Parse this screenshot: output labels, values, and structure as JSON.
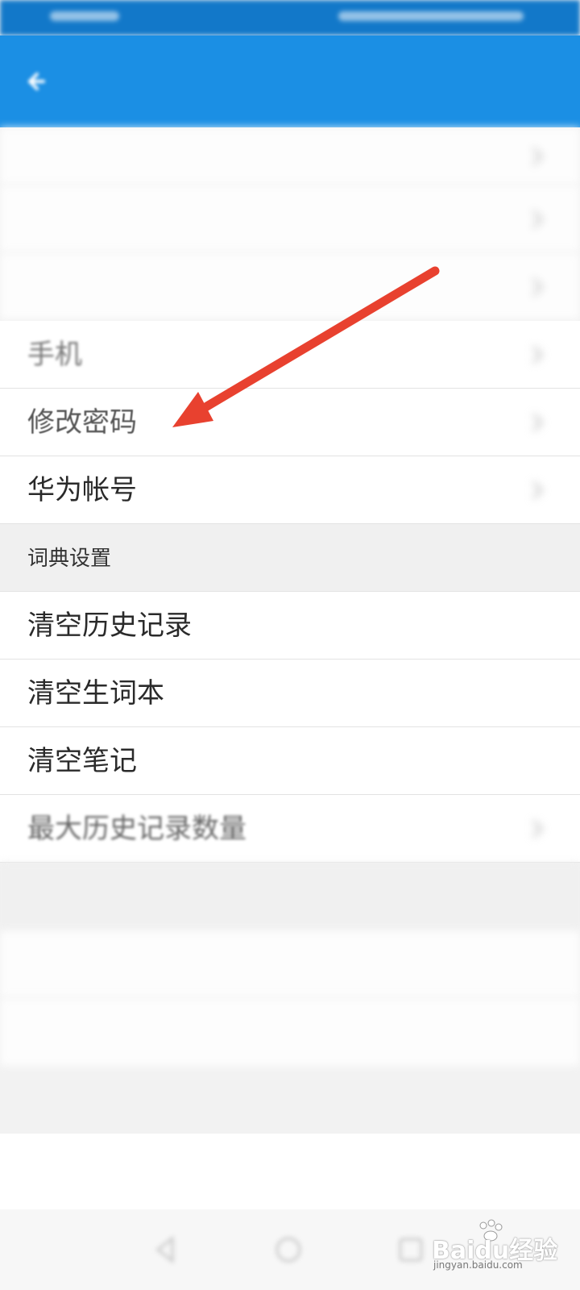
{
  "status_bar": {
    "carrier": "",
    "right_info": ""
  },
  "header": {
    "back_icon": "back-arrow-icon"
  },
  "account_rows": [
    {
      "label": "",
      "value": ""
    },
    {
      "label": "",
      "value": ""
    },
    {
      "label": "",
      "value": ""
    },
    {
      "label": "手机",
      "value": ""
    },
    {
      "label": "修改密码",
      "value": ""
    },
    {
      "label": "华为帐号",
      "value": ""
    }
  ],
  "dictionary_section": {
    "title": "词典设置",
    "items": [
      {
        "label": "清空历史记录"
      },
      {
        "label": "清空生词本"
      },
      {
        "label": "清空笔记"
      },
      {
        "label": "最大历史记录数量",
        "value": ""
      }
    ]
  },
  "backup_section": {
    "title": "",
    "items": [
      {
        "label": ""
      },
      {
        "label": ""
      }
    ]
  },
  "logout": {
    "label": ""
  },
  "annotation": {
    "color": "#e8412f"
  },
  "watermark": {
    "brand": "Baidu经验",
    "url": "jingyan.baidu.com"
  },
  "colors": {
    "appbar": "#1b8fe4",
    "statusbar": "#1278c9",
    "logout": "#e84a3c"
  }
}
